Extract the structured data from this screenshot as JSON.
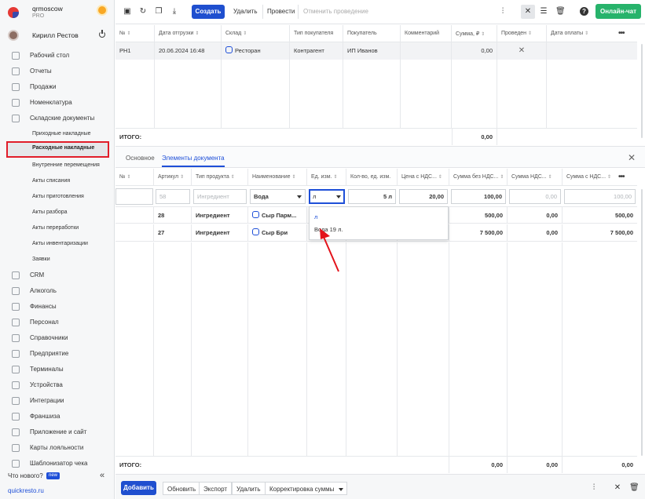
{
  "app": {
    "org": "qrmoscow",
    "plan": "PRO",
    "user": "Кирилл Рестов",
    "site": "quickresto.ru",
    "whats_new": "Что нового?",
    "new_badge": "new"
  },
  "sidebar": {
    "items": [
      {
        "label": "Рабочий стол",
        "icon": "dashboard-icon"
      },
      {
        "label": "Отчеты",
        "icon": "reports-icon"
      },
      {
        "label": "Продажи",
        "icon": "sales-icon"
      },
      {
        "label": "Номенклатура",
        "icon": "nomenclature-icon"
      },
      {
        "label": "Складские документы",
        "icon": "warehouse-icon"
      },
      {
        "label": "CRM",
        "icon": "crm-icon"
      },
      {
        "label": "Алкоголь",
        "icon": "alcohol-icon"
      },
      {
        "label": "Финансы",
        "icon": "finance-icon"
      },
      {
        "label": "Персонал",
        "icon": "staff-icon"
      },
      {
        "label": "Справочники",
        "icon": "directory-icon"
      },
      {
        "label": "Предприятие",
        "icon": "enterprise-icon"
      },
      {
        "label": "Терминалы",
        "icon": "terminal-icon"
      },
      {
        "label": "Устройства",
        "icon": "devices-icon"
      },
      {
        "label": "Интеграции",
        "icon": "integrations-icon"
      },
      {
        "label": "Франшиза",
        "icon": "franchise-icon"
      },
      {
        "label": "Приложение и сайт",
        "icon": "app-site-icon"
      },
      {
        "label": "Карты лояльности",
        "icon": "loyalty-icon"
      },
      {
        "label": "Шаблонизатор чека",
        "icon": "receipt-icon"
      }
    ],
    "subitems": [
      "Приходные накладные",
      "Расходные накладные",
      "Внутренние перемещения",
      "Акты списания",
      "Акты приготовления",
      "Акты разбора",
      "Акты переработки",
      "Акты инвентаризации",
      "Заявки"
    ],
    "active_subitem": "Расходные накладные"
  },
  "toolbar": {
    "create": "Создать",
    "delete": "Удалить",
    "post": "Провести",
    "unpost": "Отменить проведение",
    "chat": "Онлайн-чат"
  },
  "documents": {
    "columns": [
      "№",
      "Дата отгрузки",
      "Склад",
      "Тип покупателя",
      "Покупатель",
      "Комментарий",
      "Сумма, ₽",
      "Проведен",
      "Дата оплаты"
    ],
    "rows": [
      {
        "num": "РН1",
        "date": "20.06.2024 16:48",
        "warehouse": "Ресторан",
        "buyer_type": "Контрагент",
        "buyer": "ИП Иванов",
        "comment": "",
        "sum": "0,00",
        "posted": "✕",
        "pay_date": ""
      }
    ],
    "total_label": "ИТОГО:",
    "total_sum": "0,00"
  },
  "tabs": {
    "main": "Основное",
    "elements": "Элементы документа"
  },
  "elements": {
    "columns": [
      "№",
      "Артикул",
      "Тип продукта",
      "Наименование",
      "Ед. изм.",
      "Кол-во, ед. изм.",
      "Цена с НДС...",
      "Сумма без НДС...",
      "Сумма НДС...",
      "Сумма с НДС..."
    ],
    "edit_row": {
      "article": "58",
      "type": "Ингредиент",
      "name": "Вода",
      "unit": "л",
      "qty": "5 л",
      "price": "20,00",
      "sum_no_vat": "100,00",
      "vat": "0,00",
      "sum_vat": "100,00"
    },
    "rows": [
      {
        "article": "28",
        "type": "Ингредиент",
        "name": "Сыр Парм...",
        "sum_no_vat": "500,00",
        "vat": "0,00",
        "sum_vat": "500,00"
      },
      {
        "article": "27",
        "type": "Ингредиент",
        "name": "Сыр Бри",
        "sum_no_vat": "7 500,00",
        "vat": "0,00",
        "sum_vat": "7 500,00"
      }
    ],
    "unit_options": [
      "л",
      "Вода 19 л."
    ],
    "total_label": "ИТОГО:",
    "total_sum_no_vat": "0,00",
    "total_vat": "0,00",
    "total_sum_vat": "0,00"
  },
  "footer": {
    "add": "Добавить",
    "refresh": "Обновить",
    "export": "Экспорт",
    "delete": "Удалить",
    "correction": "Корректировка суммы"
  },
  "colors": {
    "primary": "#1f4fcf",
    "green": "#27b36b",
    "highlight": "#e11d2a"
  }
}
